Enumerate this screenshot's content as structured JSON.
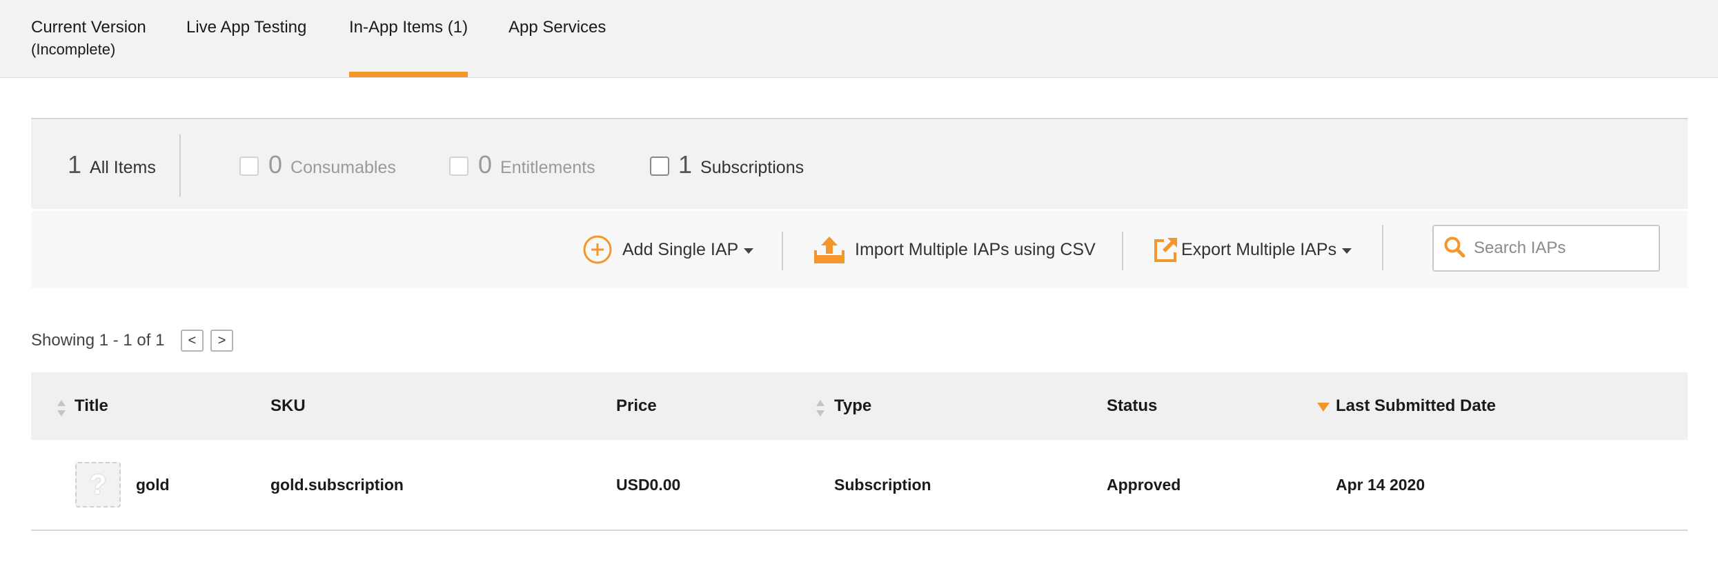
{
  "tabs": [
    {
      "label": "Current Version",
      "sub": "(Incomplete)"
    },
    {
      "label": "Live App Testing"
    },
    {
      "label": "In-App Items (1)"
    },
    {
      "label": "App Services"
    }
  ],
  "filters": {
    "all": {
      "count": "1",
      "label": "All Items"
    },
    "consumables": {
      "count": "0",
      "label": "Consumables"
    },
    "entitlements": {
      "count": "0",
      "label": "Entitlements"
    },
    "subscriptions": {
      "count": "1",
      "label": "Subscriptions"
    }
  },
  "actions": {
    "add": "Add Single IAP",
    "import": "Import Multiple IAPs using CSV",
    "export": "Export Multiple IAPs"
  },
  "search": {
    "placeholder": "Search IAPs"
  },
  "pagination": {
    "showing": "Showing 1 - 1 of 1",
    "prev": "<",
    "next": ">"
  },
  "table": {
    "headers": {
      "title": "Title",
      "sku": "SKU",
      "price": "Price",
      "type": "Type",
      "status": "Status",
      "last_submitted": "Last Submitted Date"
    },
    "rows": [
      {
        "thumb": "?",
        "title": "gold",
        "sku": "gold.subscription",
        "price": "USD0.00",
        "type": "Subscription",
        "status": "Approved",
        "last_submitted": "Apr 14 2020"
      }
    ]
  },
  "colors": {
    "accent": "#f4962a",
    "header_bg": "#f2f2f2"
  }
}
